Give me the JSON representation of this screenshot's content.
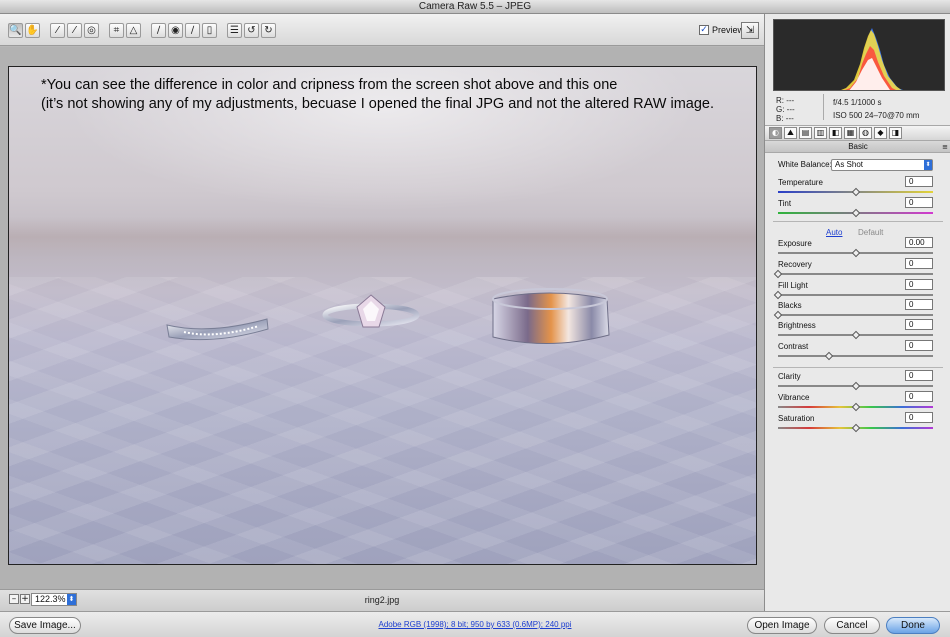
{
  "window": {
    "title": "Camera Raw 5.5  –  JPEG"
  },
  "toolbar": {
    "tools": [
      {
        "name": "zoom-tool",
        "glyph": "🔍"
      },
      {
        "name": "hand-tool",
        "glyph": "✋"
      },
      {
        "name": "white-balance-tool",
        "glyph": "⁄"
      },
      {
        "name": "color-sampler-tool",
        "glyph": "⁄"
      },
      {
        "name": "targeted-adjustment-tool",
        "glyph": "◎"
      },
      {
        "name": "crop-tool",
        "glyph": "⌗"
      },
      {
        "name": "straighten-tool",
        "glyph": "△"
      },
      {
        "name": "spot-removal-tool",
        "glyph": "∕"
      },
      {
        "name": "red-eye-tool",
        "glyph": "◉"
      },
      {
        "name": "adjustment-brush-tool",
        "glyph": "∕"
      },
      {
        "name": "graduated-filter-tool",
        "glyph": "▯"
      },
      {
        "name": "preferences-tool",
        "glyph": "☰"
      },
      {
        "name": "rotate-ccw-tool",
        "glyph": "↺"
      },
      {
        "name": "rotate-cw-tool",
        "glyph": "↻"
      }
    ],
    "preview_label": "Preview",
    "preview_check": "✓",
    "fullscreen_glyph": "⇲"
  },
  "canvas": {
    "note_line1": "*You can see the difference in color and cripness from the screen shot above and this one",
    "note_line2": "(it’s not showing any of my adjustments, becuase I opened the final JPG and not the altered RAW image."
  },
  "status": {
    "zoom_out_glyph": "–",
    "zoom_in_glyph": "+",
    "zoom_value": "122.3%",
    "select_arrow": "⬍",
    "filename": "ring2.jpg"
  },
  "bottom": {
    "save_label": "Save Image...",
    "workflow_link": "Adobe RGB (1998); 8 bit; 950 by 633 (0.6MP); 240 ppi",
    "open_label": "Open Image",
    "cancel_label": "Cancel",
    "done_label": "Done"
  },
  "info": {
    "r": "R:  ---",
    "g": "G:  ---",
    "b": "B:  ---",
    "exif1": "f/4.5   1/1000 s",
    "exif2": "ISO 500   24–70@70 mm"
  },
  "panel": {
    "tabs": [
      "◐",
      "⛰",
      "▤",
      "▥",
      "◧",
      "▦",
      "◍",
      "◆",
      "◨"
    ],
    "header": "Basic",
    "menu_glyph": "≡",
    "white_balance_label": "White Balance:",
    "white_balance_value": "As Shot",
    "auto_label": "Auto",
    "default_label": "Default",
    "sliders": [
      {
        "name": "temperature",
        "label": "Temperature",
        "value": "0",
        "level": 0.5
      },
      {
        "name": "tint",
        "label": "Tint",
        "value": "0",
        "level": 0.5
      },
      {
        "name": "exposure",
        "label": "Exposure",
        "value": "0.00",
        "level": 0.5
      },
      {
        "name": "recovery",
        "label": "Recovery",
        "value": "0",
        "level": 0.0
      },
      {
        "name": "fill-light",
        "label": "Fill Light",
        "value": "0",
        "level": 0.0
      },
      {
        "name": "blacks",
        "label": "Blacks",
        "value": "0",
        "level": 0.0
      },
      {
        "name": "brightness",
        "label": "Brightness",
        "value": "0",
        "level": 0.5
      },
      {
        "name": "contrast",
        "label": "Contrast",
        "value": "0",
        "level": 0.33
      },
      {
        "name": "clarity",
        "label": "Clarity",
        "value": "0",
        "level": 0.5
      },
      {
        "name": "vibrance",
        "label": "Vibrance",
        "value": "0",
        "level": 0.5
      },
      {
        "name": "saturation",
        "label": "Saturation",
        "value": "0",
        "level": 0.5
      }
    ]
  },
  "colors": {
    "accent": "#2e6fd8",
    "link": "#1d3ecf",
    "panel_bg": "#e9e9e9"
  }
}
